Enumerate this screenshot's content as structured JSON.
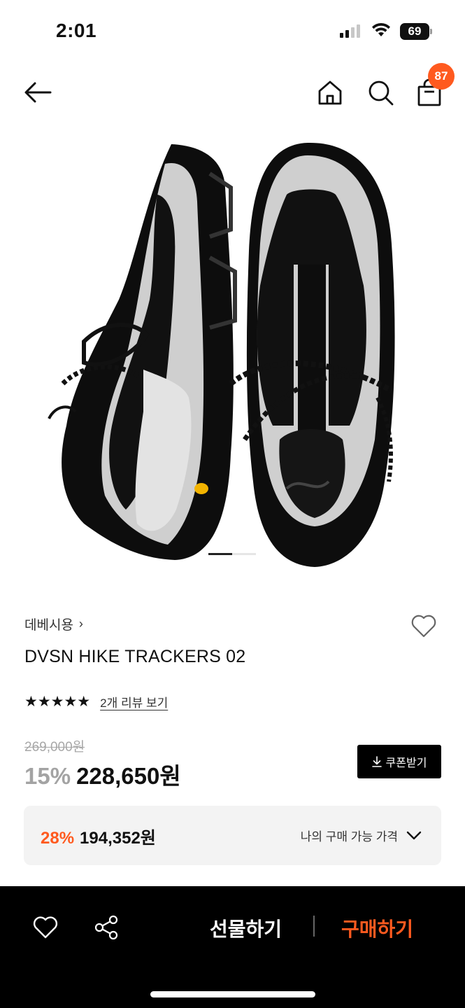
{
  "status_bar": {
    "time": "2:01",
    "battery": "69"
  },
  "nav": {
    "cart_count": "87"
  },
  "product": {
    "brand": "데베시용",
    "title": "DVSN HIKE TRACKERS 02",
    "stars": "★★★★★",
    "review_link": "2개 리뷰 보기",
    "original_price": "269,000원",
    "discount": "15%",
    "sale_price": "228,650원",
    "coupon_label": "쿠폰받기",
    "image_index": 1,
    "image_count": 2
  },
  "my_price": {
    "discount": "28%",
    "price": "194,352원",
    "label": "나의 구매 가능 가격"
  },
  "bottom_bar": {
    "gift_label": "선물하기",
    "buy_label": "구매하기"
  },
  "colors": {
    "accent": "#ff5a1f",
    "bar_background": "#000000",
    "panel_background": "#f3f3f3"
  }
}
